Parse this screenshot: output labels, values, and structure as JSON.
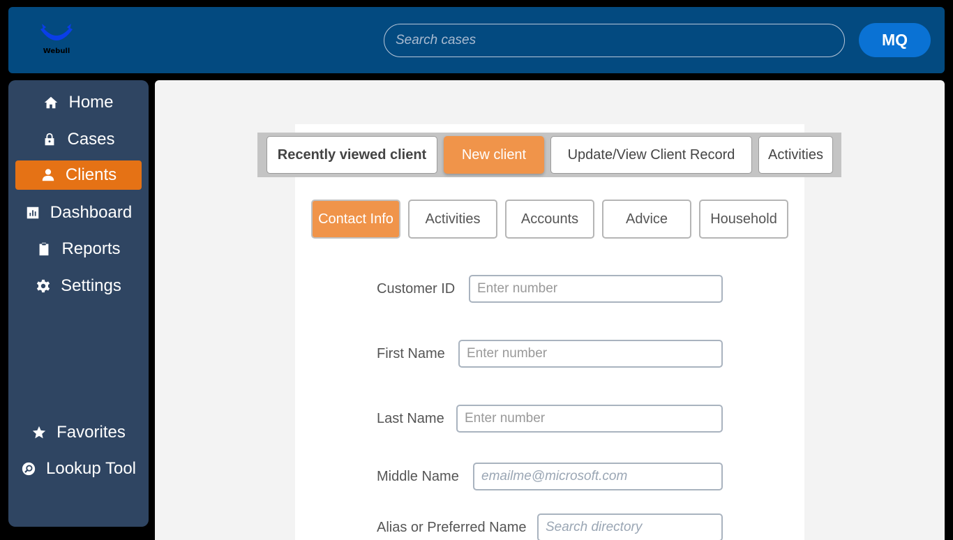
{
  "header": {
    "logo_text": "Webull",
    "logo_color": "#0a3ee8",
    "search_placeholder": "Search cases",
    "user_initials": "MQ"
  },
  "sidebar": {
    "items": [
      {
        "label": "Home",
        "icon": "home-icon"
      },
      {
        "label": "Cases",
        "icon": "lock-icon"
      },
      {
        "label": "Clients",
        "icon": "person-icon",
        "active": true
      },
      {
        "label": "Dashboard",
        "icon": "bar-chart-icon"
      },
      {
        "label": "Reports",
        "icon": "clipboard-icon"
      },
      {
        "label": "Settings",
        "icon": "gear-icon"
      }
    ],
    "bottom_items": [
      {
        "label": "Favorites",
        "icon": "star-icon"
      },
      {
        "label": "Lookup Tool",
        "icon": "magnifier-icon"
      }
    ],
    "active_color": "#e57215"
  },
  "main": {
    "tabs": [
      {
        "label": "Recently viewed client"
      },
      {
        "label": "New client",
        "active": true
      },
      {
        "label": "Update/View Client Record"
      },
      {
        "label": "Activities"
      }
    ],
    "subtabs": [
      {
        "label": "Contact Info",
        "active": true
      },
      {
        "label": "Activities"
      },
      {
        "label": "Accounts"
      },
      {
        "label": "Advice"
      },
      {
        "label": "Household"
      }
    ],
    "form": {
      "fields": [
        {
          "label": "Customer ID",
          "placeholder": "Enter number",
          "value": ""
        },
        {
          "label": "First Name",
          "placeholder": "Enter number",
          "value": ""
        },
        {
          "label": "Last Name",
          "placeholder": "Enter number",
          "value": ""
        },
        {
          "label": "Middle Name",
          "placeholder": "emailme@microsoft.com",
          "value": ""
        },
        {
          "label": "Alias or Preferred Name",
          "placeholder": "Search directory",
          "value": ""
        }
      ]
    },
    "accent_color": "#f0944a"
  }
}
